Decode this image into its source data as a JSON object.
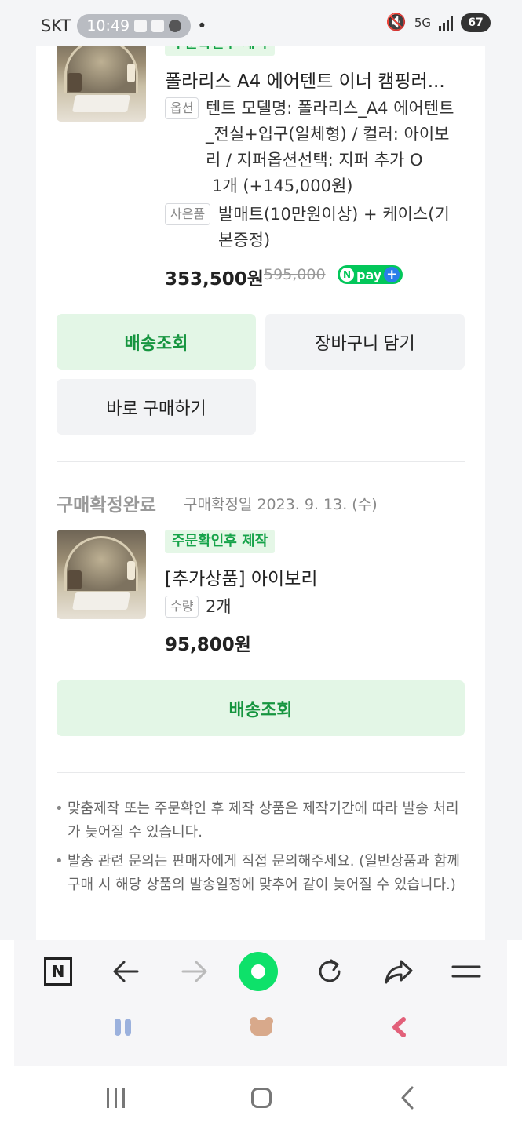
{
  "status_bar": {
    "carrier": "SKT",
    "time": "10:49",
    "battery": "67"
  },
  "order1": {
    "badge": "주문확인후 제작",
    "title": "폴라리스 A4 에어텐트 이너 캠핑러...",
    "option_tag": "옵션",
    "option_lines": [
      "텐트 모델명: 폴라리스_A4 에어텐트",
      "_전실+입구(일체형) / 컬러: 아이보",
      "리 / 지퍼옵션선택: 지퍼 추가 O",
      "1개 (+145,000원)"
    ],
    "gift_tag": "사은품",
    "gift_lines": [
      "발매트(10만원이상) + 케이스(기",
      "본증정)"
    ],
    "price": "353,500원",
    "price_original": "595,000",
    "npay_label": "pay",
    "npay_n": "N",
    "npay_plus": "+",
    "buttons": {
      "track": "배송조회",
      "cart": "장바구니 담기",
      "buy_now": "바로 구매하기"
    }
  },
  "order2": {
    "status": "구매확정완료",
    "date_label": "구매확정일 2023. 9. 13. (수)",
    "badge": "주문확인후 제작",
    "title": "[추가상품] 아이보리",
    "qty_tag": "수량",
    "qty_value": "2개",
    "price": "95,800원",
    "buttons": {
      "track": "배송조회"
    }
  },
  "notices": [
    "맞춤제작 또는 주문확인 후 제작 상품은 제작기간에 따라 발송 처리가 늦어질 수 있습니다.",
    "발송 관련 문의는 판매자에게 직접 문의해주세요. (일반상품과 함께 구매 시 해당 상품의 발송일정에 맞추어 같이 늦어질 수 있습니다.)"
  ],
  "toolbar": {
    "n_label": "N",
    "icons": [
      "n-home-icon",
      "back-arrow-icon",
      "forward-arrow-icon",
      "green-dot-icon",
      "refresh-icon",
      "share-icon",
      "menu-icon"
    ]
  },
  "colors": {
    "green_text": "#16953f",
    "green_bg": "#e3f6e6",
    "npay_green": "#03c75a",
    "gray_bg": "#f2f3f5"
  }
}
